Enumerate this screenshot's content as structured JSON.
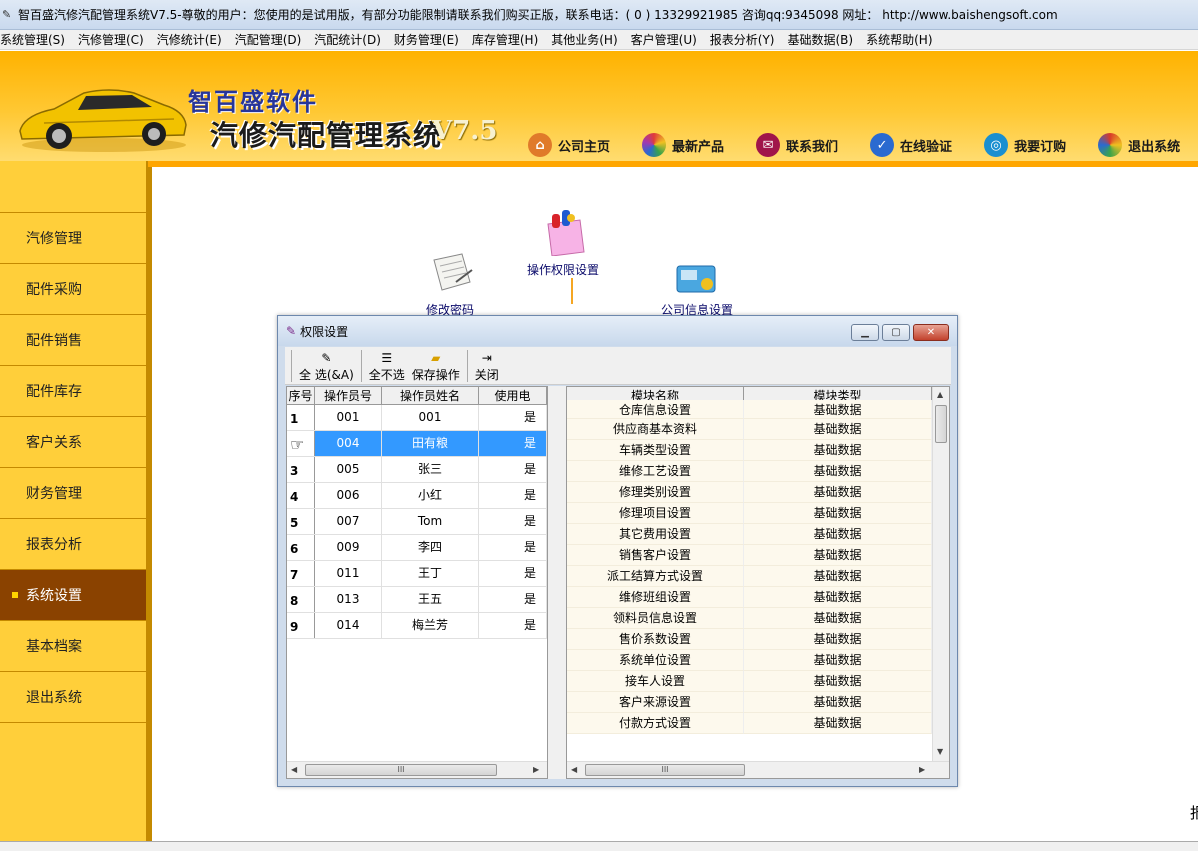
{
  "window": {
    "title": "智百盛汽修汽配管理系统V7.5-尊敬的用户：您使用的是试用版，有部分功能限制请联系我们购买正版，联系电话：( 0 ) 13329921985  咨询qq:9345098   网址： http://www.baishengsoft.com"
  },
  "menu": [
    "系统管理(S)",
    "汽修管理(C)",
    "汽修统计(E)",
    "汽配管理(D)",
    "汽配统计(D)",
    "财务管理(E)",
    "库存管理(H)",
    "其他业务(H)",
    "客户管理(U)",
    "报表分析(Y)",
    "基础数据(B)",
    "系统帮助(H)"
  ],
  "banner": {
    "brand_line1": "智百盛软件",
    "brand_line2": "汽修汽配管理系统",
    "brand_version": "V7.5"
  },
  "topnav": [
    {
      "label": "公司主页",
      "icon": "home-icon",
      "color": "#e07a2a"
    },
    {
      "label": "最新产品",
      "icon": "colorwheel-icon",
      "color": "#3aa34a"
    },
    {
      "label": "联系我们",
      "icon": "contact-icon",
      "color": "#a0154a"
    },
    {
      "label": "在线验证",
      "icon": "verify-icon",
      "color": "#2a6ad0"
    },
    {
      "label": "我要订购",
      "icon": "order-icon",
      "color": "#1a8fd0"
    },
    {
      "label": "退出系统",
      "icon": "exit-icon",
      "color": "#d83a2a"
    }
  ],
  "sidebar": {
    "items": [
      "汽修管理",
      "配件采购",
      "配件销售",
      "配件库存",
      "客户关系",
      "财务管理",
      "报表分析",
      "系统设置",
      "基本档案",
      "退出系统"
    ],
    "active_index": 7
  },
  "desktop": {
    "perm_label": "操作权限设置",
    "pwd_label": "修改密码",
    "company_label": "公司信息设置",
    "edge_char": "报"
  },
  "dialog": {
    "title": "权限设置",
    "buttons": {
      "minimize": "▁",
      "maximize": "▢",
      "close": "✕"
    },
    "toolbar": {
      "select_all": "全   选(&A)",
      "select_none": "全不选",
      "save": "保存操作",
      "close": "关闭"
    },
    "left_grid": {
      "headers": [
        "序号",
        "操作员号",
        "操作员姓名",
        "使用电"
      ],
      "rows": [
        {
          "seq": "1",
          "id": "001",
          "name": "001",
          "use": "是"
        },
        {
          "seq": "",
          "id": "004",
          "name": "田有粮",
          "use": "是"
        },
        {
          "seq": "3",
          "id": "005",
          "name": "张三",
          "use": "是"
        },
        {
          "seq": "4",
          "id": "006",
          "name": "小红",
          "use": "是"
        },
        {
          "seq": "5",
          "id": "007",
          "name": "Tom",
          "use": "是"
        },
        {
          "seq": "6",
          "id": "009",
          "name": "李四",
          "use": "是"
        },
        {
          "seq": "7",
          "id": "011",
          "name": "王丁",
          "use": "是"
        },
        {
          "seq": "8",
          "id": "013",
          "name": "王五",
          "use": "是"
        },
        {
          "seq": "9",
          "id": "014",
          "name": "梅兰芳",
          "use": "是"
        }
      ],
      "selected_index": 1,
      "hscroll_label": "III"
    },
    "right_grid": {
      "headers": [
        "模块名称",
        "模块类型"
      ],
      "rows": [
        {
          "module": "仓库信息设置",
          "type": "基础数据"
        },
        {
          "module": "供应商基本资料",
          "type": "基础数据"
        },
        {
          "module": "车辆类型设置",
          "type": "基础数据"
        },
        {
          "module": "维修工艺设置",
          "type": "基础数据"
        },
        {
          "module": "修理类别设置",
          "type": "基础数据"
        },
        {
          "module": "修理项目设置",
          "type": "基础数据"
        },
        {
          "module": "其它费用设置",
          "type": "基础数据"
        },
        {
          "module": "销售客户设置",
          "type": "基础数据"
        },
        {
          "module": "派工结算方式设置",
          "type": "基础数据"
        },
        {
          "module": "维修班组设置",
          "type": "基础数据"
        },
        {
          "module": "领料员信息设置",
          "type": "基础数据"
        },
        {
          "module": "售价系数设置",
          "type": "基础数据"
        },
        {
          "module": "系统单位设置",
          "type": "基础数据"
        },
        {
          "module": "接车人设置",
          "type": "基础数据"
        },
        {
          "module": "客户来源设置",
          "type": "基础数据"
        },
        {
          "module": "付款方式设置",
          "type": "基础数据"
        }
      ],
      "hscroll_label": "III"
    }
  }
}
